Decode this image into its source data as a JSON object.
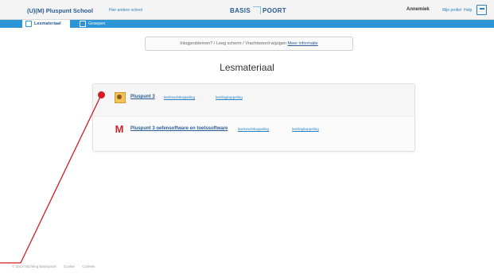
{
  "header": {
    "school": "(U)(M) Pluspunt School",
    "other_school": "Hier andere school",
    "brand_left": "BASIS",
    "brand_right": "POORT",
    "user": "Annemiek",
    "my_profile": "Mijn profiel",
    "help": "Help"
  },
  "tabs": {
    "lesmateriaal": "Lesmateriaal",
    "groepen": "Groepen"
  },
  "notice": {
    "text": "Inlogproblemen? / Leeg scherm / Vrachtwoord wijzigen",
    "link": "Meer informatie"
  },
  "page": {
    "title": "Lesmateriaal"
  },
  "products": [
    {
      "name": "Pluspunt 3",
      "teacher_link": "leerkrachtkoppeling",
      "student_link": "leerlingkoppeling"
    },
    {
      "name": "Pluspunt 3 oefensoftware en toetssoftware",
      "teacher_link": "leerkrachtkoppeling",
      "student_link": "leerlingkoppeling"
    }
  ],
  "footer": {
    "copyright": "© 2013 Stichting Basispoort",
    "links": [
      "Cookie",
      "Cookies"
    ]
  },
  "colors": {
    "accent": "#2b95d6",
    "callout": "#d01c22"
  }
}
